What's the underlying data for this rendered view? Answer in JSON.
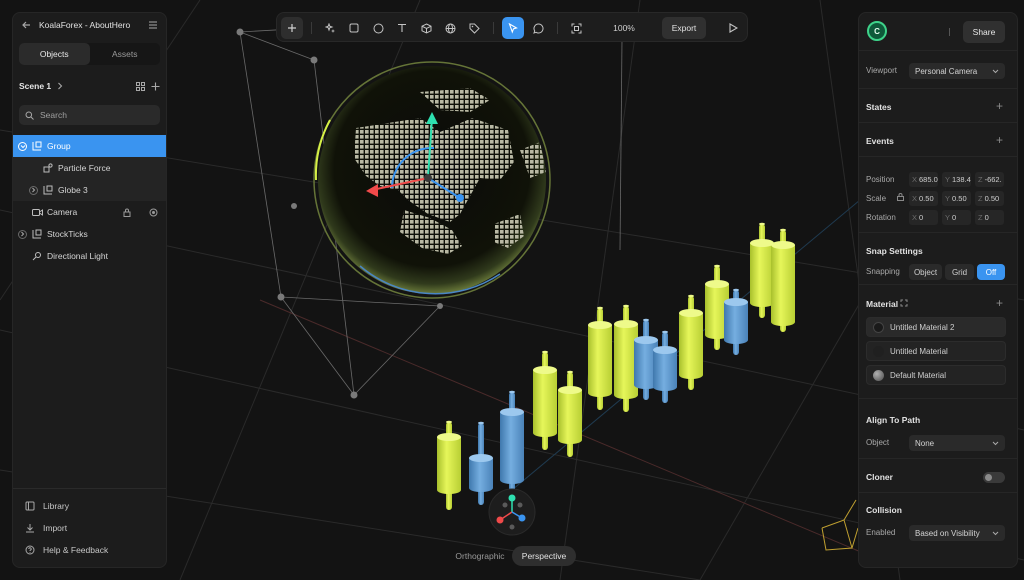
{
  "project": {
    "name": "KoalaForex - AboutHero"
  },
  "left_panel": {
    "tabs": [
      {
        "label": "Objects",
        "active": true
      },
      {
        "label": "Assets",
        "active": false
      }
    ],
    "scene": {
      "label": "Scene 1"
    },
    "search": {
      "placeholder": "Search"
    },
    "tree": [
      {
        "label": "Group",
        "icon": "group-icon",
        "selected": true,
        "expanded": true
      },
      {
        "label": "Particle Force",
        "icon": "particle-force-icon",
        "child": true
      },
      {
        "label": "Globe 3",
        "icon": "group-icon",
        "child": true
      },
      {
        "label": "Camera",
        "icon": "camera-icon"
      },
      {
        "label": "StockTicks",
        "icon": "group-icon"
      },
      {
        "label": "Directional Light",
        "icon": "light-icon"
      }
    ],
    "bottom": [
      {
        "label": "Library",
        "icon": "library-icon"
      },
      {
        "label": "Import",
        "icon": "import-icon"
      },
      {
        "label": "Help & Feedback",
        "icon": "help-icon"
      }
    ]
  },
  "toolbar": {
    "tools": [
      "add-icon",
      "magic-icon",
      "rectangle-icon",
      "ellipse-icon",
      "text-icon",
      "cube-icon",
      "sphere-icon",
      "tag-icon",
      "pointer-icon",
      "comment-icon",
      "frame-icon"
    ],
    "active_tool": "pointer-icon",
    "zoom": "100%",
    "export_label": "Export"
  },
  "right_panel": {
    "avatar_initial": "C",
    "share_label": "Share",
    "viewport": {
      "label": "Viewport",
      "value": "Personal Camera"
    },
    "states": {
      "title": "States"
    },
    "events": {
      "title": "Events"
    },
    "transform": {
      "position": {
        "label": "Position",
        "x": "685.0",
        "y": "138.4",
        "z": "-662."
      },
      "scale": {
        "label": "Scale",
        "x": "0.50",
        "y": "0.50",
        "z": "0.50"
      },
      "rotation": {
        "label": "Rotation",
        "x": "0",
        "y": "0",
        "z": "0"
      }
    },
    "snap": {
      "title": "Snap Settings",
      "label": "Snapping",
      "options": [
        "Object",
        "Grid",
        "Off"
      ],
      "active": "Off"
    },
    "material": {
      "title": "Material",
      "items": [
        {
          "label": "Untitled Material 2",
          "swatch": "#1a1a1a"
        },
        {
          "label": "Untitled Material",
          "swatch": "#202020"
        },
        {
          "label": "Default Material",
          "swatch": "#7a7a7a"
        }
      ]
    },
    "align": {
      "title": "Align To Path",
      "label": "Object",
      "value": "None"
    },
    "cloner": {
      "title": "Cloner",
      "enabled": false
    },
    "collision": {
      "title": "Collision",
      "label": "Enabled",
      "value": "Based on Visibility"
    }
  },
  "camera_mode": {
    "options": [
      "Orthographic",
      "Perspective"
    ],
    "active": "Perspective"
  },
  "colors": {
    "accent": "#3a94f0",
    "yellow_candle": "#d6f046",
    "blue_candle": "#5b97cc",
    "background": "#131313"
  }
}
